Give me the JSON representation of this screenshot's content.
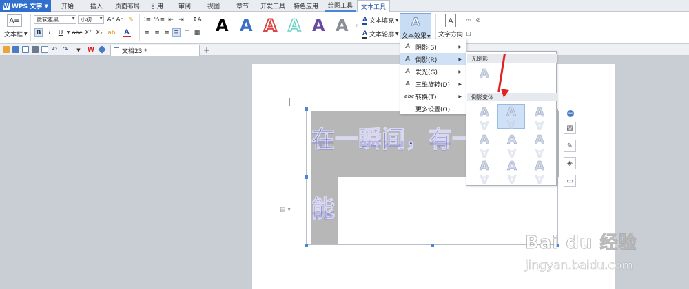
{
  "app": {
    "name": "WPS 文字",
    "logo_letter": "W"
  },
  "tabs": [
    "开始",
    "插入",
    "页面布局",
    "引用",
    "审阅",
    "视图",
    "章节",
    "开发工具",
    "特色应用",
    "绘图工具",
    "文本工具"
  ],
  "ribbon": {
    "textbox_label": "文本框",
    "font_name": "微软雅黑",
    "font_size": "小初",
    "bold": "B",
    "italic": "I",
    "underline": "U",
    "strike": "abc",
    "superscript": "X²",
    "subscript": "X₂",
    "text_fill": "文本填充",
    "text_outline": "文本轮廓",
    "text_effect": "文本效果",
    "text_direction": "文字方向",
    "style_letter": "A"
  },
  "quickbar": {
    "doc_tab": "文档23 *"
  },
  "document": {
    "line1": "在一瞬间，有一",
    "line2": "能"
  },
  "effect_menu": {
    "items": [
      {
        "label": "阴影(S)",
        "icon": "A"
      },
      {
        "label": "倒影(R)",
        "icon": "A"
      },
      {
        "label": "发光(G)",
        "icon": "A"
      },
      {
        "label": "三维旋转(D)",
        "icon": "A"
      },
      {
        "label": "转换(T)",
        "icon": "abc"
      },
      {
        "label": "更多设置(O)..."
      }
    ]
  },
  "reflection_submenu": {
    "none_header": "无倒影",
    "variants_header": "倒影变体",
    "sample_letter": "A"
  },
  "watermark": {
    "logo": "Bai du 经验",
    "url": "jingyan.baidu.com"
  },
  "colors": {
    "accent": "#2f6fce",
    "highlight": "#cfe1f6",
    "arrow": "#e02424",
    "text_effect": "#4b4fb0"
  }
}
